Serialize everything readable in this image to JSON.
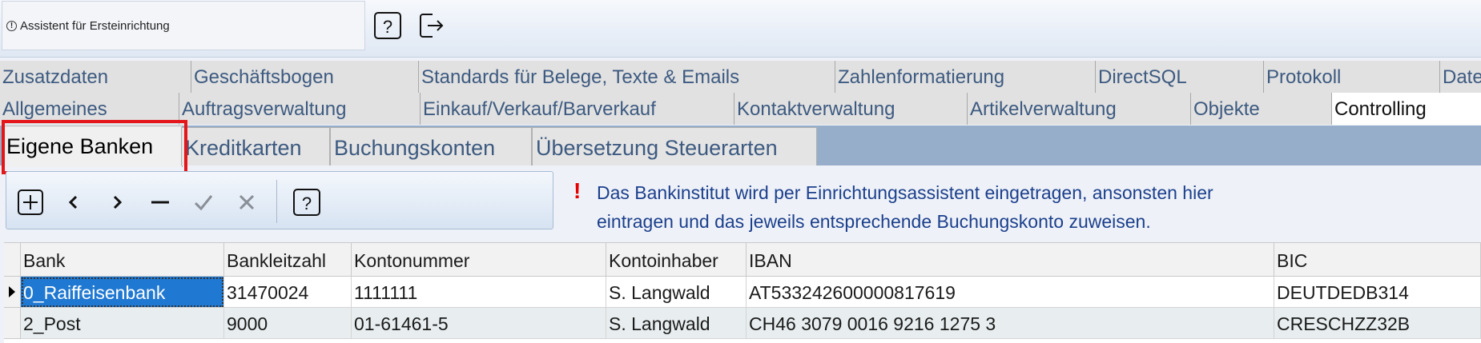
{
  "assistant": {
    "label": "Assistent für Ersteinrichtung"
  },
  "top_icons": [
    "help-icon",
    "exit-icon"
  ],
  "tabs_row1": [
    {
      "label": "Zusatzdaten"
    },
    {
      "label": "Geschäftsbogen"
    },
    {
      "label": "Standards für Belege, Texte & Emails"
    },
    {
      "label": "Zahlenformatierung"
    },
    {
      "label": "DirectSQL"
    },
    {
      "label": "Protokoll"
    },
    {
      "label": "Date"
    }
  ],
  "tabs_row2": [
    {
      "label": "Allgemeines"
    },
    {
      "label": "Auftragsverwaltung"
    },
    {
      "label": "Einkauf/Verkauf/Barverkauf"
    },
    {
      "label": "Kontaktverwaltung"
    },
    {
      "label": "Artikelverwaltung"
    },
    {
      "label": "Objekte"
    },
    {
      "label": "Controlling",
      "selected": true
    }
  ],
  "subtabs": [
    {
      "label": "Eigene Banken",
      "selected": true
    },
    {
      "label": "Kreditkarten"
    },
    {
      "label": "Buchungskonten"
    },
    {
      "label": "Übersetzung Steuerarten"
    }
  ],
  "toolbar": {
    "buttons": [
      "add-icon",
      "previous-icon",
      "next-icon",
      "delete-icon",
      "confirm-icon",
      "cancel-icon",
      "help-icon"
    ]
  },
  "hint": {
    "icon": "!",
    "line1": "Das Bankinstitut wird per Einrichtungsassistent eingetragen, ansonsten hier",
    "line2": "eintragen und das jeweils entsprechende Buchungskonto zuweisen."
  },
  "table": {
    "columns": [
      "Bank",
      "Bankleitzahl",
      "Kontonummer",
      "Kontoinhaber",
      "IBAN",
      "BIC"
    ],
    "rows": [
      [
        "0_Raiffeisenbank",
        "31470024",
        "1111111",
        "S. Langwald",
        "AT533242600000817619",
        "DEUTDEDB314"
      ],
      [
        "2_Post",
        "9000",
        "01-61461-5",
        "S. Langwald",
        "CH46 3079 0016 9216 1275 3",
        "CRESCHZZ32B"
      ]
    ]
  },
  "colors": {
    "tab_text": "#3d5a80",
    "subtab_strip": "#97aecb",
    "highlight_border": "#e4161a",
    "selected_cell": "#1f78d1",
    "hint_text": "#1c3f8c"
  }
}
